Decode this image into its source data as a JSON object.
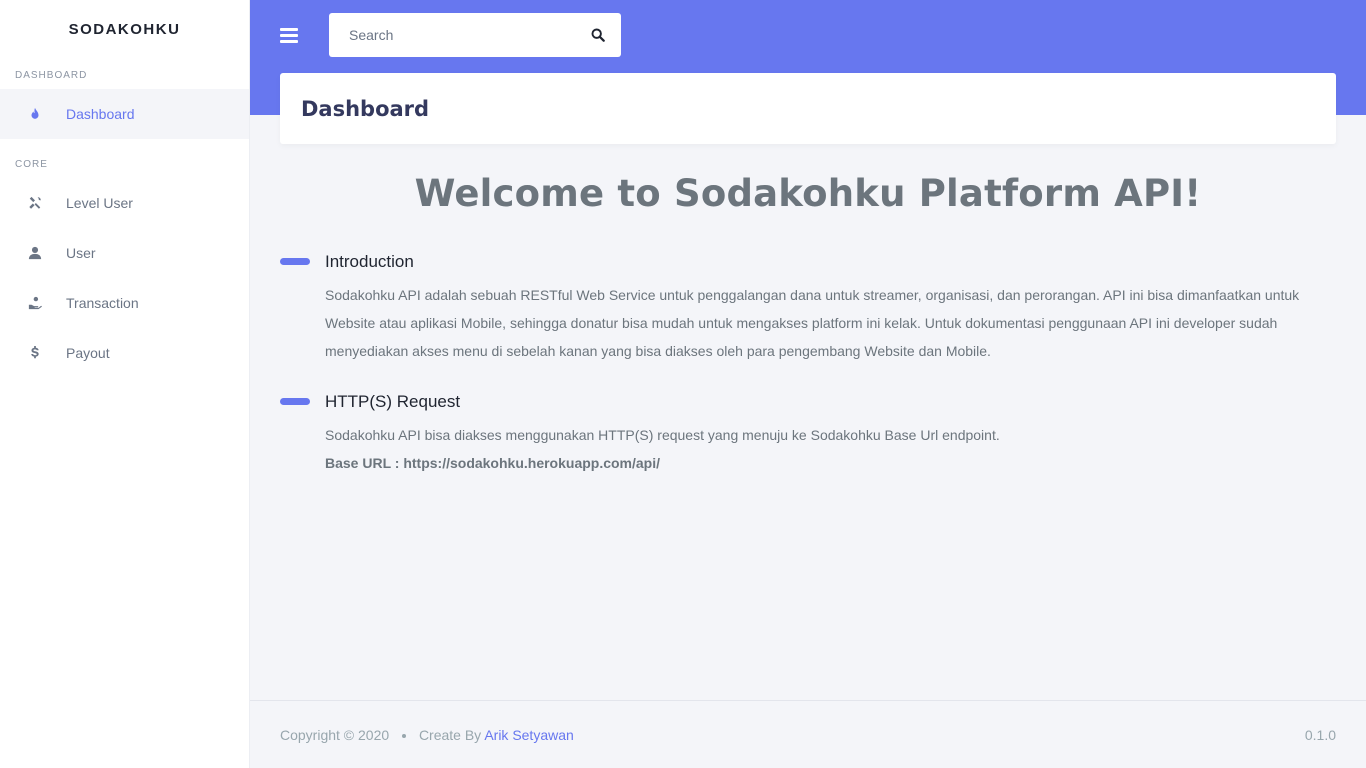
{
  "sidebar": {
    "brand": "SODAKOHKU",
    "sections": [
      {
        "heading": "DASHBOARD"
      },
      {
        "heading": "CORE"
      }
    ],
    "items": [
      {
        "label": "Dashboard",
        "icon": "fire-icon",
        "active": true
      },
      {
        "label": "Level User",
        "icon": "tools-icon"
      },
      {
        "label": "User",
        "icon": "user-icon"
      },
      {
        "label": "Transaction",
        "icon": "hand-holding-coin-icon"
      },
      {
        "label": "Payout",
        "icon": "dollar-icon"
      }
    ]
  },
  "topbar": {
    "search_placeholder": "Search",
    "search_icon": "search-icon",
    "menu_icon": "hamburger-icon"
  },
  "page": {
    "title": "Dashboard",
    "welcome": "Welcome to Sodakohku Platform API!",
    "sections": [
      {
        "title": "Introduction",
        "body": "Sodakohku API adalah sebuah RESTful Web Service untuk penggalangan dana untuk streamer, organisasi, dan perorangan. API ini bisa dimanfaatkan untuk Website atau aplikasi Mobile, sehingga donatur bisa mudah untuk mengakses platform ini kelak. Untuk dokumentasi penggunaan API ini developer sudah menyediakan akses menu di sebelah kanan yang bisa diakses oleh para pengembang Website dan Mobile."
      },
      {
        "title": "HTTP(S) Request",
        "body": "Sodakohku API bisa diakses menggunakan HTTP(S) request yang menuju ke Sodakohku Base Url endpoint.",
        "base_url": "Base URL : https://sodakohku.herokuapp.com/api/"
      }
    ]
  },
  "footer": {
    "copyright": "Copyright © 2020",
    "create_by": "Create By",
    "author": "Arik Setyawan",
    "version": "0.1.0"
  },
  "colors": {
    "primary": "#6777ef",
    "background": "#f4f5f9",
    "sidebar_bg": "#ffffff"
  }
}
